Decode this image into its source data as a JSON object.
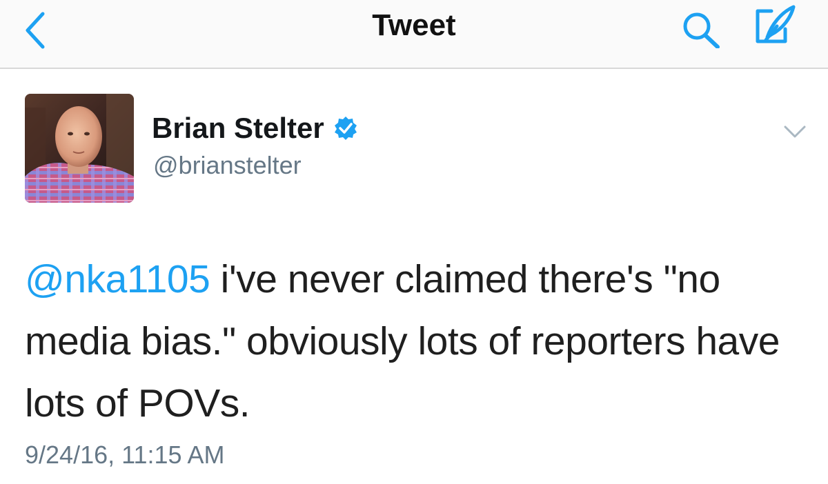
{
  "navbar": {
    "title": "Tweet",
    "back_icon": "chevron-left-icon",
    "search_icon": "search-icon",
    "compose_icon": "compose-icon",
    "accent_color": "#1da1f2"
  },
  "tweet": {
    "author": {
      "name": "Brian Stelter",
      "handle": "@brianstelter",
      "verified": true
    },
    "mention": "@nka1105",
    "text": " i've never claimed there's \"no media bias.\" obviously lots of reporters have lots of POVs.",
    "timestamp": "9/24/16, 11:15 AM"
  }
}
